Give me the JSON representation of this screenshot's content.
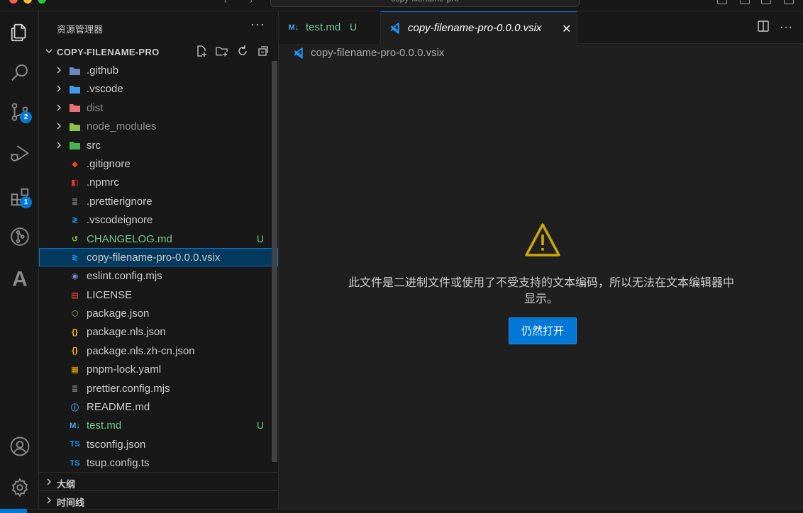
{
  "titlebar": {
    "command_center": "copy-filename-pro"
  },
  "activity_bar": {
    "items": [
      {
        "name": "explorer-icon"
      },
      {
        "name": "search-icon"
      },
      {
        "name": "source-control-icon",
        "badge": "2"
      },
      {
        "name": "run-debug-icon"
      },
      {
        "name": "extensions-icon",
        "badge": "1"
      },
      {
        "name": "git-graph-icon"
      },
      {
        "name": "font-a-icon"
      }
    ],
    "bottom": [
      {
        "name": "accounts-icon"
      },
      {
        "name": "manage-gear-icon"
      }
    ]
  },
  "sidebar": {
    "title": "资源管理器",
    "more": "···",
    "project": "COPY-FILENAME-PRO",
    "files": [
      {
        "label": ".github",
        "type": "folder",
        "icon_color": "#6a8abf"
      },
      {
        "label": ".vscode",
        "type": "folder",
        "icon_color": "#3d9be9"
      },
      {
        "label": "dist",
        "type": "folder",
        "icon_color": "#e57373",
        "dim": true
      },
      {
        "label": "node_modules",
        "type": "folder",
        "icon_color": "#8bc34a",
        "dim": true
      },
      {
        "label": "src",
        "type": "folder",
        "icon_color": "#4caf50"
      },
      {
        "label": ".gitignore",
        "type": "file",
        "icon_color": "#e64a19"
      },
      {
        "label": ".npmrc",
        "type": "file",
        "icon_color": "#e53935"
      },
      {
        "label": ".prettierignore",
        "type": "file",
        "icon_color": "#8d8d8d"
      },
      {
        "label": ".vscodeignore",
        "type": "file",
        "icon_color": "#2196f3"
      },
      {
        "label": "CHANGELOG.md",
        "type": "file",
        "icon_color": "#8bc34a",
        "git": "U"
      },
      {
        "label": "copy-filename-pro-0.0.0.vsix",
        "type": "file",
        "icon_color": "#2196f3",
        "selected": true
      },
      {
        "label": "eslint.config.mjs",
        "type": "file",
        "icon_color": "#7986cb"
      },
      {
        "label": "LICENSE",
        "type": "file",
        "icon_color": "#ff5722"
      },
      {
        "label": "package.json",
        "type": "file",
        "icon_color": "#8bc34a"
      },
      {
        "label": "package.nls.json",
        "type": "file",
        "icon_color": "#fbc02d"
      },
      {
        "label": "package.nls.zh-cn.json",
        "type": "file",
        "icon_color": "#fbc02d"
      },
      {
        "label": "pnpm-lock.yaml",
        "type": "file",
        "icon_color": "#f9ad00"
      },
      {
        "label": "prettier.config.mjs",
        "type": "file",
        "icon_color": "#8d8d8d"
      },
      {
        "label": "README.md",
        "type": "file",
        "icon_color": "#42a5f5"
      },
      {
        "label": "test.md",
        "type": "file",
        "icon_color": "#42a5f5",
        "git": "U"
      },
      {
        "label": "tsconfig.json",
        "type": "file",
        "icon_color": "#2196f3"
      },
      {
        "label": "tsup.config.ts",
        "type": "file",
        "icon_color": "#2196f3"
      }
    ],
    "outline": "大纲",
    "timeline": "时间线"
  },
  "editor": {
    "tabs": [
      {
        "label": "test.md",
        "status": "U",
        "active": false
      },
      {
        "label": "copy-filename-pro-0.0.0.vsix",
        "active": true
      }
    ],
    "breadcrumb": "copy-filename-pro-0.0.0.vsix",
    "message": "此文件是二进制文件或使用了不受支持的文本编码，所以无法在文本编辑器中显示。",
    "open_anyway": "仍然打开"
  },
  "colors": {
    "accent": "#0078d4",
    "git_untracked": "#73c991",
    "warning": "#cca700"
  }
}
